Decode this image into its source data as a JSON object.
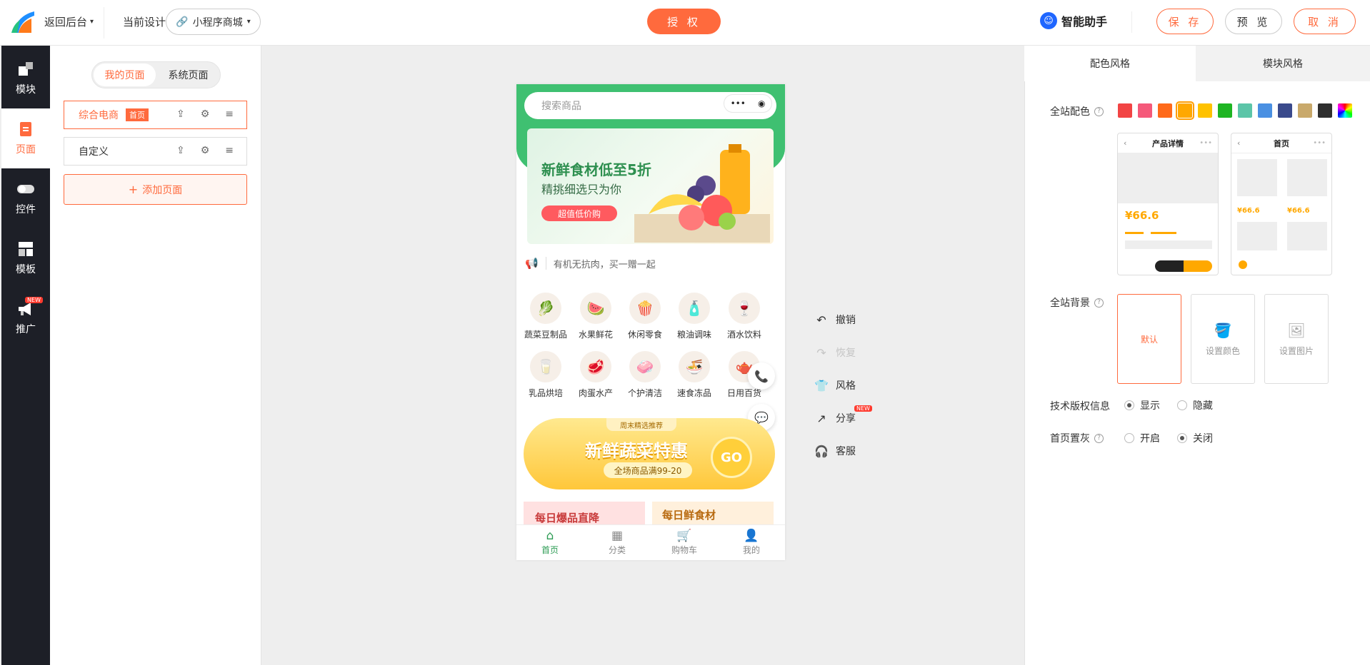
{
  "topbar": {
    "back_label": "返回后台",
    "current_design_label": "当前设计",
    "app_select": "小程序商城",
    "authorize": "授 权",
    "assistant": "智能助手",
    "save": "保 存",
    "preview": "预 览",
    "cancel": "取 消"
  },
  "leftnav": {
    "items": [
      {
        "label": "模块",
        "icon": "blocks-icon"
      },
      {
        "label": "页面",
        "icon": "page-icon"
      },
      {
        "label": "控件",
        "icon": "toggle-icon"
      },
      {
        "label": "模板",
        "icon": "template-icon"
      },
      {
        "label": "推广",
        "icon": "megaphone-icon",
        "badge": "NEW"
      }
    ]
  },
  "pagepanel": {
    "tabs": [
      "我的页面",
      "系统页面"
    ],
    "pages": [
      {
        "name": "综合电商",
        "tag": "首页"
      },
      {
        "name": "自定义"
      }
    ],
    "add_page": "添加页面"
  },
  "phone": {
    "search_placeholder": "搜索商品",
    "banner": {
      "title": "新鲜食材低至5折",
      "subtitle": "精挑细选只为你",
      "button": "超值低价购"
    },
    "notice": "有机无抗肉，买一赠一起",
    "categories": [
      {
        "label": "蔬菜豆制品",
        "icon": "🥬"
      },
      {
        "label": "水果鲜花",
        "icon": "🍉"
      },
      {
        "label": "休闲零食",
        "icon": "🍿"
      },
      {
        "label": "粮油调味",
        "icon": "🧴"
      },
      {
        "label": "酒水饮料",
        "icon": "🍷"
      },
      {
        "label": "乳品烘培",
        "icon": "🥛"
      },
      {
        "label": "肉蛋水产",
        "icon": "🥩"
      },
      {
        "label": "个护清洁",
        "icon": "🧼"
      },
      {
        "label": "速食冻品",
        "icon": "🍜"
      },
      {
        "label": "日用百货",
        "icon": "🫖"
      }
    ],
    "promo": {
      "tag": "周末精选推荐",
      "title": "新鲜蔬菜特惠",
      "sub": "全场商品满99-20",
      "go": "GO"
    },
    "mini_cards": [
      "每日爆品直降",
      "每日鲜食材"
    ],
    "tabs": [
      {
        "label": "首页",
        "icon": "home-icon"
      },
      {
        "label": "分类",
        "icon": "grid-icon"
      },
      {
        "label": "购物车",
        "icon": "cart-icon"
      },
      {
        "label": "我的",
        "icon": "user-icon"
      }
    ]
  },
  "side_actions": [
    {
      "label": "撤销",
      "icon": "undo-icon"
    },
    {
      "label": "恢复",
      "icon": "redo-icon"
    },
    {
      "label": "风格",
      "icon": "shirt-icon"
    },
    {
      "label": "分享",
      "icon": "share-icon",
      "badge": "NEW"
    },
    {
      "label": "客服",
      "icon": "headset-icon"
    }
  ],
  "rightpanel": {
    "tabs": [
      "配色风格",
      "模块风格"
    ],
    "color_label": "全站配色",
    "swatches": [
      "#f24444",
      "#f5597a",
      "#ff6a1a",
      "#ffa800",
      "#ffc200",
      "#1fb523",
      "#5cc5a8",
      "#4a90e2",
      "#3a4a8c",
      "#c9a96b",
      "#2f2f2f",
      "rainbow"
    ],
    "selected_swatch": 3,
    "preview_cards": [
      {
        "title": "产品详情",
        "price": "¥66.6"
      },
      {
        "title": "首页",
        "price1": "¥66.6",
        "price2": "¥66.6"
      }
    ],
    "bg_label": "全站背景",
    "bg_options": [
      "默认",
      "设置颜色",
      "设置图片"
    ],
    "copyright_label": "技术版权信息",
    "copyright_options": [
      "显示",
      "隐藏"
    ],
    "gray_label": "首页置灰",
    "gray_options": [
      "开启",
      "关闭"
    ]
  },
  "colors": {
    "accent": "#ff6a3d",
    "brand_green": "#3fc071",
    "sidebar": "#1d1f27"
  }
}
